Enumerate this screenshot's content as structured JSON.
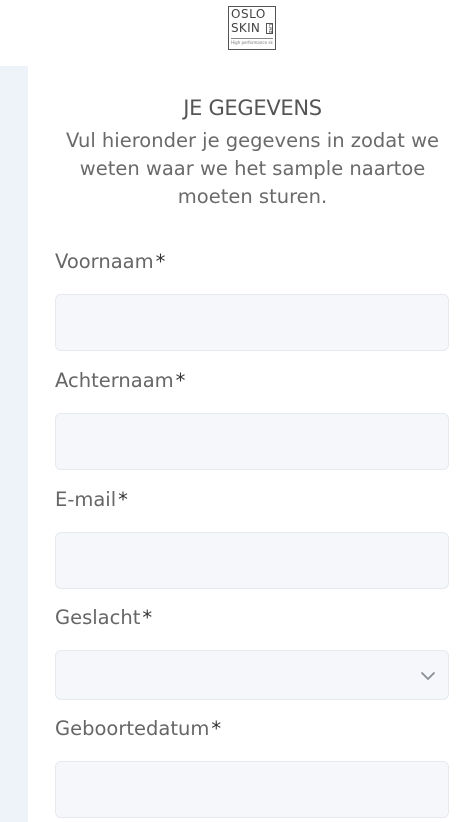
{
  "brand": {
    "line1": "OSLO",
    "line2": "SKIN",
    "badge": "LAB",
    "tagline": "High performance skin care"
  },
  "form": {
    "title": "JE GEGEVENS",
    "subtitle": "Vul hieronder je gegevens in zodat we weten waar we het sample naartoe moeten sturen.",
    "required_mark": "*",
    "fields": [
      {
        "label": "Voornaam",
        "value": "",
        "type": "text"
      },
      {
        "label": "Achternaam",
        "value": "",
        "type": "text"
      },
      {
        "label": "E-mail",
        "value": "",
        "type": "email"
      },
      {
        "label": "Geslacht",
        "value": "",
        "type": "select"
      },
      {
        "label": "Geboortedatum",
        "value": "",
        "type": "text"
      }
    ]
  },
  "icons": {
    "select_chevron": "chevron-down-icon"
  },
  "colors": {
    "field_background": "#f5f7fa",
    "side_stripe": "#eef3fa",
    "text": "#666666"
  }
}
